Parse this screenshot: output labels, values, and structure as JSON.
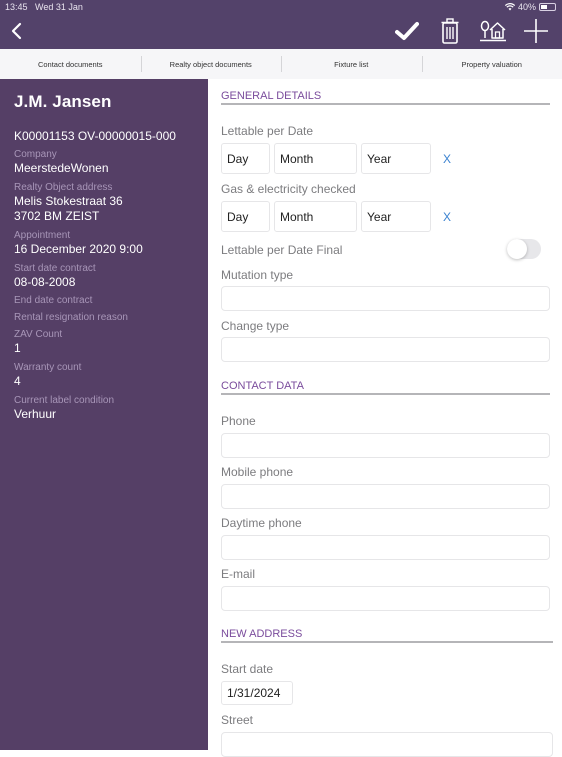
{
  "status_bar": {
    "time": "13:45",
    "date": "Wed 31 Jan",
    "battery_percent": "40%"
  },
  "toolbar": {
    "icons": [
      "back-chevron-icon",
      "checkmark-icon",
      "trash-icon",
      "tree-house-icon",
      "plus-icon"
    ]
  },
  "tabs": [
    {
      "label": "Contact documents"
    },
    {
      "label": "Realty object documents"
    },
    {
      "label": "Fixture list"
    },
    {
      "label": "Property valuation"
    }
  ],
  "sidebar": {
    "name": "J.M. Jansen",
    "code": "K00001153  OV-00000015-000",
    "company_label": "Company",
    "company": "MeerstedeWonen",
    "address_label": "Realty Object address",
    "address_line1": "Melis Stokestraat 36",
    "address_line2": "3702 BM  ZEIST",
    "appointment_label": "Appointment",
    "appointment": "16 December 2020  9:00",
    "start_date_label": "Start date contract",
    "start_date": "08-08-2008",
    "end_date_label": "End date contract",
    "resignation_label": "Rental resignation reason",
    "zav_label": "ZAV Count",
    "zav": "1",
    "warranty_label": "Warranty count",
    "warranty": "4",
    "label_condition_label": "Current label condition",
    "label_condition": "Verhuur"
  },
  "main": {
    "general": {
      "title": "GENERAL DETAILS",
      "lettable_label": "Lettable per Date",
      "gas_label": "Gas & electricity checked",
      "day_placeholder": "Day",
      "month_placeholder": "Month",
      "year_placeholder": "Year",
      "clear": "X",
      "final_label": "Lettable per Date Final",
      "final_on": false,
      "mutation_label": "Mutation type",
      "mutation_value": "",
      "change_label": "Change type",
      "change_value": ""
    },
    "contact": {
      "title": "CONTACT DATA",
      "phone_label": "Phone",
      "phone_value": "",
      "mobile_label": "Mobile phone",
      "mobile_value": "",
      "daytime_label": "Daytime phone",
      "daytime_value": "",
      "email_label": "E-mail",
      "email_value": ""
    },
    "new_address": {
      "title": "NEW ADDRESS",
      "start_label": "Start date",
      "start_value": "1/31/2024",
      "street_label": "Street",
      "street_value": ""
    }
  },
  "colors": {
    "header_bg": "#53426a",
    "sidebar_bg": "#553f66",
    "section_title": "#7a4c9c",
    "link_blue": "#3b82d0"
  }
}
